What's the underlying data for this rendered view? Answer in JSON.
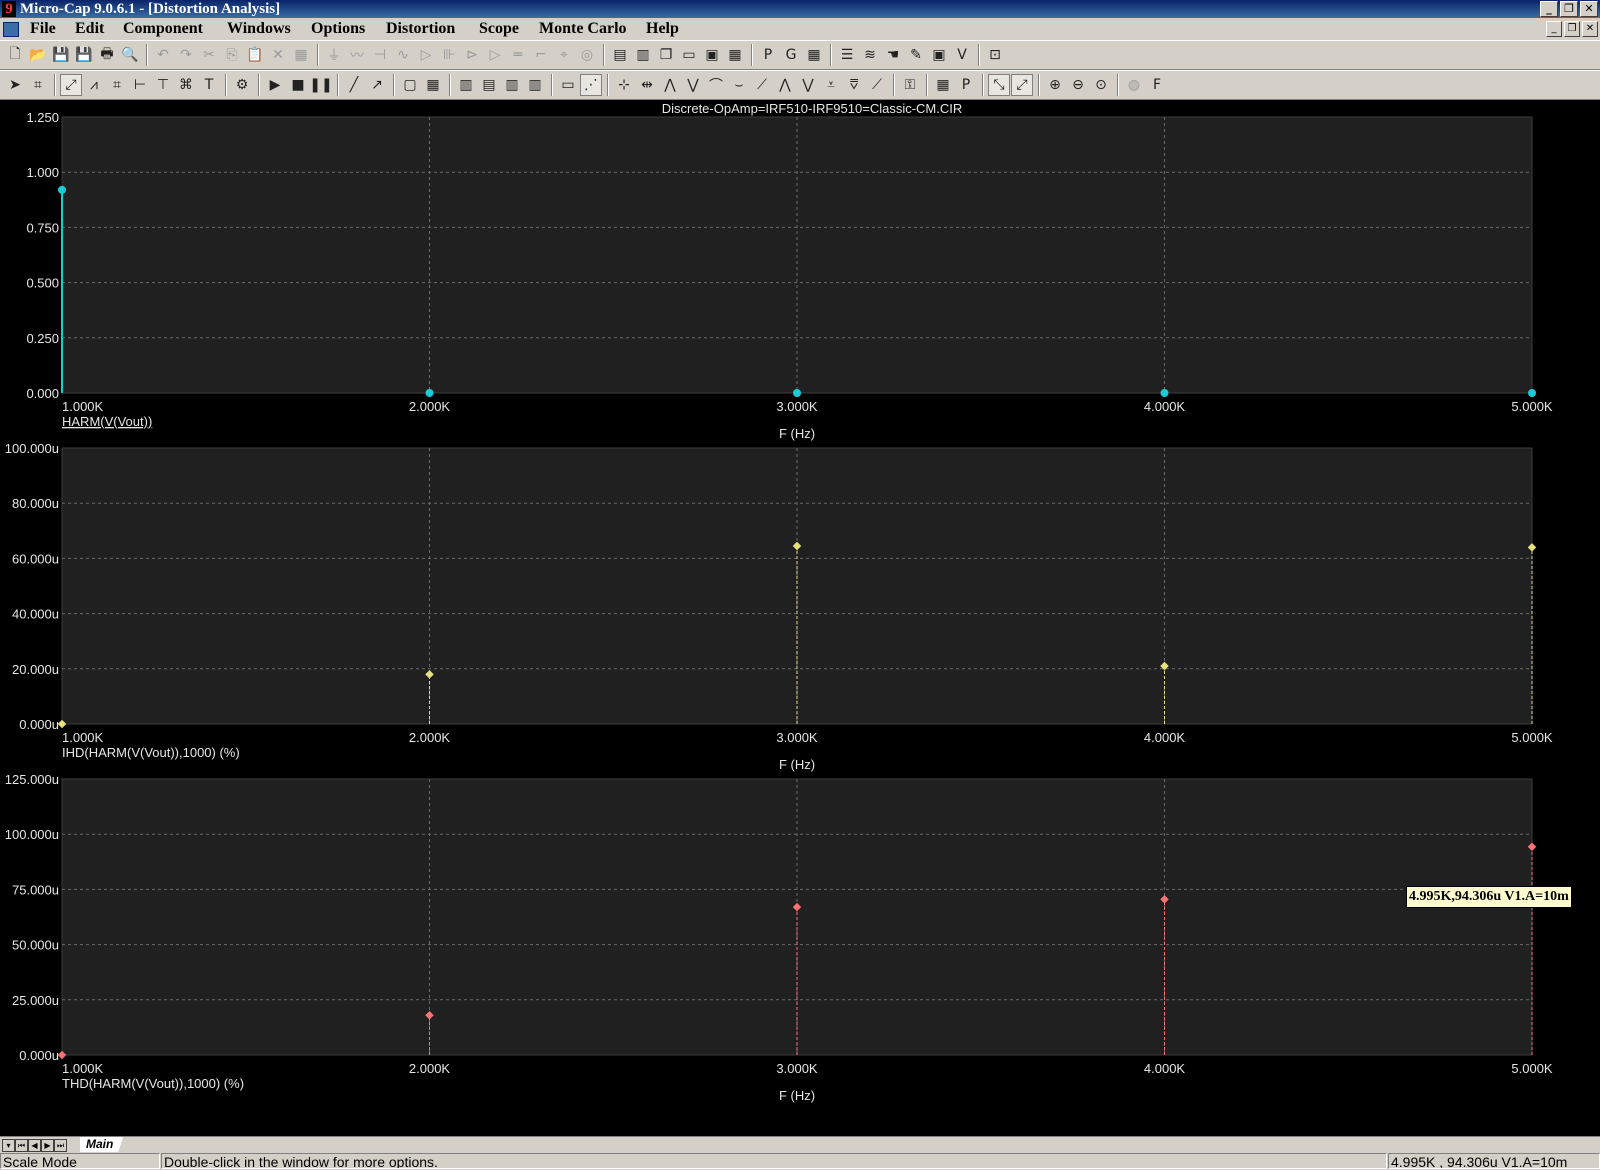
{
  "window": {
    "title": "Micro-Cap 9.0.6.1 - [Distortion Analysis]"
  },
  "menu": [
    "File",
    "Edit",
    "Component",
    "Windows",
    "Options",
    "Distortion",
    "Scope",
    "Monte Carlo",
    "Help"
  ],
  "toolbar1": [
    "new-icon",
    "open-icon",
    "save-icon",
    "save-all-icon",
    "print-icon",
    "print-preview-icon",
    "|",
    "undo-icon",
    "redo-icon",
    "cut-icon",
    "copy-icon",
    "paste-icon",
    "delete-icon",
    "select-all-icon",
    "|",
    "ground-icon",
    "resistor-icon",
    "capacitor-icon",
    "inductor-icon",
    "diode-icon",
    "battery-icon",
    "npn-icon",
    "opamp-icon",
    "bus-icon",
    "jumper-icon",
    "probe-icon",
    "source-icon",
    "|",
    "tile-horizontal-icon",
    "tile-vertical-icon",
    "cascade-icon",
    "window-icon",
    "window2-icon",
    "calculator-icon",
    "|",
    "p-key-icon",
    "g-key-icon",
    "grid-icon",
    "|",
    "list-icon",
    "waveform-icon",
    "hand-icon",
    "pen-icon",
    "plot-icon",
    "v-ab-icon",
    "|",
    "probe-window-icon"
  ],
  "toolbar2": [
    "select-arrow-icon",
    "component-mode-icon",
    "|",
    "scale-mode-icon",
    "cursor-mode-icon",
    "point-tag-icon",
    "horizontal-tag-icon",
    "vertical-tag-icon",
    "performance-tag-icon",
    "text-icon",
    "|",
    "properties-icon",
    "|",
    "run-icon",
    "stop-icon",
    "pause-icon",
    "|",
    "line-icon",
    "arrow-icon",
    "|",
    "box-icon",
    "grid-icon",
    "|",
    "minor-grid-icon",
    "data-points-icon",
    "token-icon",
    "ruler-icon",
    "|",
    "plus-minus-icon",
    "cursor-icon",
    "|",
    "baseline-icon",
    "same-y-icon",
    "peak-icon",
    "valley-icon",
    "high-icon",
    "low-icon",
    "inflection-icon",
    "global-high-icon",
    "global-low-icon",
    "top-icon",
    "bottom-icon",
    "slope-icon",
    "|",
    "tag-mode-icon",
    "|",
    "table-icon",
    "p-label-icon",
    "|",
    "scale-x-icon",
    "scale-y-icon",
    "|",
    "zoom-in-icon",
    "zoom-out-icon",
    "zoom-fit-icon",
    "|",
    "globe-icon",
    "f-key-icon"
  ],
  "plots": {
    "circuit_title": "Discrete-OpAmp=IRF510-IRF9510=Classic-CM.CIR",
    "x_label": "F (Hz)",
    "cursor_readout": "4.995K,94.306u V1.A=10m"
  },
  "chart_data": [
    {
      "type": "scatter",
      "title": "Discrete-OpAmp=IRF510-IRF9510=Classic-CM.CIR",
      "xlabel": "F (Hz)",
      "x_ticks": [
        "1.000K",
        "2.000K",
        "3.000K",
        "4.000K",
        "5.000K"
      ],
      "y_ticks": [
        "0.000",
        "0.250",
        "0.500",
        "0.750",
        "1.000",
        "1.250"
      ],
      "xlim": [
        1000,
        5000
      ],
      "ylim": [
        0,
        1.25
      ],
      "series": [
        {
          "name": "HARM(V(Vout))",
          "color": "#19cbd6",
          "x": [
            1000,
            2000,
            3000,
            4000,
            5000
          ],
          "y": [
            0.92,
            0.0,
            0.0,
            0.0,
            0.0
          ]
        }
      ]
    },
    {
      "type": "scatter",
      "xlabel": "F (Hz)",
      "x_ticks": [
        "1.000K",
        "2.000K",
        "3.000K",
        "4.000K",
        "5.000K"
      ],
      "y_ticks": [
        "0.000u",
        "20.000u",
        "40.000u",
        "60.000u",
        "80.000u",
        "100.000u"
      ],
      "xlim": [
        1000,
        5000
      ],
      "ylim": [
        0,
        100
      ],
      "series": [
        {
          "name": "IHD(HARM(V(Vout)),1000) (%)",
          "color": "#e8e07a",
          "x": [
            1000,
            2000,
            3000,
            4000,
            5000
          ],
          "y": [
            0,
            18,
            64.5,
            21,
            64
          ]
        }
      ]
    },
    {
      "type": "scatter",
      "xlabel": "F (Hz)",
      "x_ticks": [
        "1.000K",
        "2.000K",
        "3.000K",
        "4.000K",
        "5.000K"
      ],
      "y_ticks": [
        "0.000u",
        "25.000u",
        "50.000u",
        "75.000u",
        "100.000u",
        "125.000u"
      ],
      "xlim": [
        1000,
        5000
      ],
      "ylim": [
        0,
        125
      ],
      "series": [
        {
          "name": "THD(HARM(V(Vout)),1000) (%)",
          "color": "#ff7070",
          "x": [
            1000,
            2000,
            3000,
            4000,
            5000
          ],
          "y": [
            0,
            18,
            67,
            70.5,
            94.3
          ]
        }
      ]
    }
  ],
  "tabs": {
    "main": "Main"
  },
  "status": {
    "mode": "Scale Mode",
    "hint": "Double-click in the window for more options.",
    "readout": "4.995K , 94.306u   V1.A=10m"
  }
}
